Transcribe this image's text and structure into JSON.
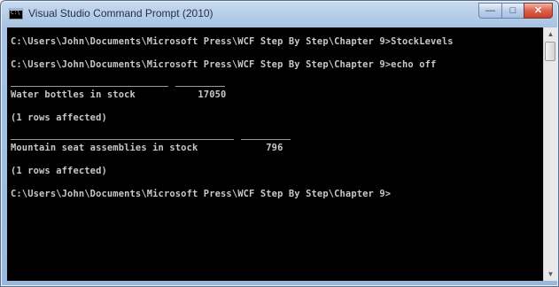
{
  "window": {
    "title": "Visual Studio Command Prompt (2010)",
    "minimize_glyph": "—",
    "maximize_glyph": "□",
    "close_glyph": "✕"
  },
  "console": {
    "lines": [
      "C:\\Users\\John\\Documents\\Microsoft Press\\WCF Step By Step\\Chapter 9>StockLevels",
      "C:\\Users\\John\\Documents\\Microsoft Press\\WCF Step By Step\\Chapter 9>echo off",
      "Water bottles in stock           17050",
      "(1 rows affected)",
      "Mountain seat assemblies in stock            796",
      "(1 rows affected)",
      "C:\\Users\\John\\Documents\\Microsoft Press\\WCF Step By Step\\Chapter 9>"
    ]
  },
  "scrollbar": {
    "up_arrow": "▲",
    "down_arrow": "▼"
  }
}
